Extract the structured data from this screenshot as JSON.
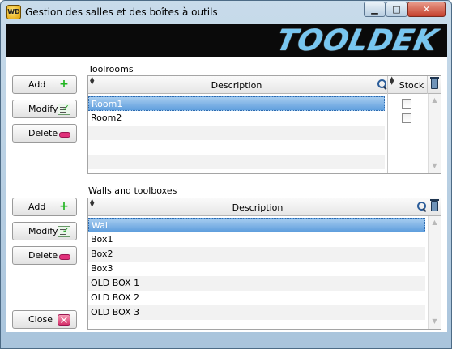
{
  "window": {
    "title": "Gestion des salles et des boîtes à outils",
    "app_icon_text": "WD",
    "minimize_glyph": "▁",
    "maximize_glyph": "□",
    "close_glyph": "✕"
  },
  "banner": {
    "logo": "TOOLDEK"
  },
  "toolrooms": {
    "label": "Toolrooms",
    "columns": {
      "description": "Description",
      "stock": "Stock"
    },
    "rows": [
      {
        "description": "Room1",
        "stock": false,
        "selected": true
      },
      {
        "description": "Room2",
        "stock": false,
        "selected": false
      }
    ],
    "buttons": {
      "add": "Add",
      "modify": "Modify",
      "delete": "Delete"
    }
  },
  "walls": {
    "label": "Walls and toolboxes",
    "columns": {
      "description": "Description"
    },
    "rows": [
      {
        "description": "Wall",
        "selected": true
      },
      {
        "description": "Box1",
        "selected": false
      },
      {
        "description": "Box2",
        "selected": false
      },
      {
        "description": "Box3",
        "selected": false
      },
      {
        "description": "OLD BOX 1",
        "selected": false
      },
      {
        "description": "OLD BOX 2",
        "selected": false
      },
      {
        "description": "OLD BOX 3",
        "selected": false
      }
    ],
    "buttons": {
      "add": "Add",
      "modify": "Modify",
      "delete": "Delete"
    }
  },
  "footer": {
    "close": "Close"
  },
  "colors": {
    "accent": "#5f9edd",
    "logo": "#78c6f0",
    "banner": "#0a0a0a"
  }
}
